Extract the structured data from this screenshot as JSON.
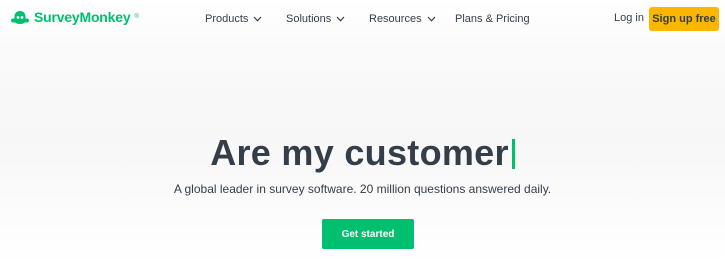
{
  "brand": {
    "name": "SurveyMonkey",
    "trademark": "®",
    "color": "#00bf6f"
  },
  "nav": {
    "items": [
      {
        "label": "Products",
        "icon": "chevron-down-icon"
      },
      {
        "label": "Solutions",
        "icon": "chevron-down-icon"
      },
      {
        "label": "Resources",
        "icon": "chevron-down-icon"
      },
      {
        "label": "Plans & Pricing"
      }
    ],
    "login_label": "Log in",
    "signup_label": "Sign up free",
    "signup_color": "#fdb600"
  },
  "hero": {
    "title": "Are my customer",
    "subtitle": "A global leader in survey software. 20 million questions answered daily.",
    "cta_label": "Get started",
    "cta_color": "#00bf6f",
    "caret_color": "#00bf6f"
  }
}
